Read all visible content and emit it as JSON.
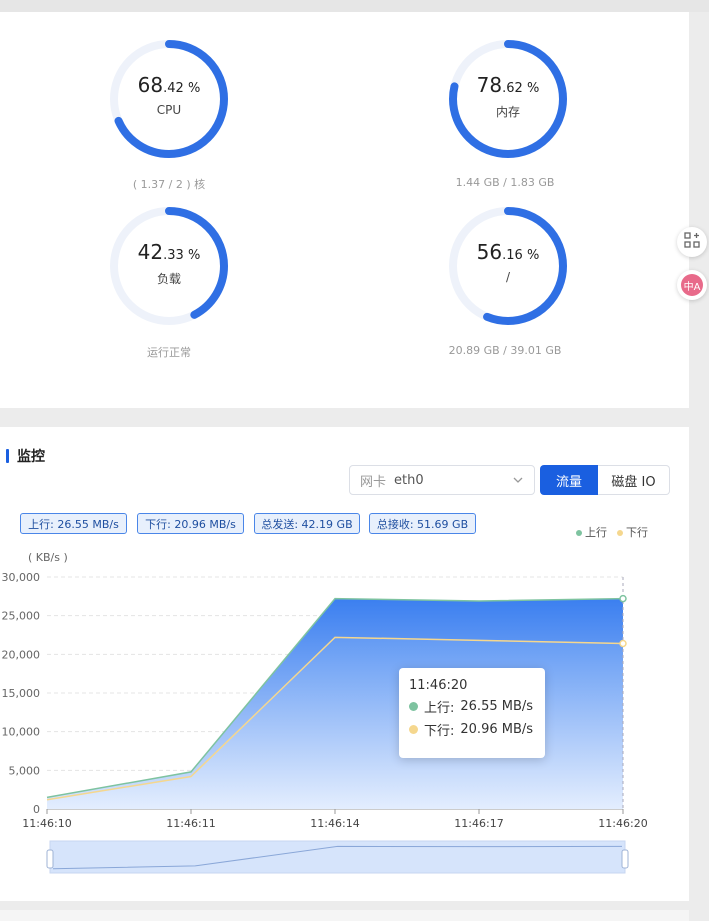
{
  "gauges": [
    {
      "int": "68",
      "dec": ".42",
      "unit": "%",
      "label": "CPU",
      "sub": "( 1.37 / 2 ) 核",
      "percent": 68.42
    },
    {
      "int": "78",
      "dec": ".62",
      "unit": "%",
      "label": "内存",
      "sub": "1.44 GB / 1.83 GB",
      "percent": 78.62
    },
    {
      "int": "42",
      "dec": ".33",
      "unit": "%",
      "label": "负载",
      "sub": "运行正常",
      "percent": 42.33
    },
    {
      "int": "56",
      "dec": ".16",
      "unit": "%",
      "label": "/",
      "sub": "20.89 GB / 39.01 GB",
      "percent": 56.16
    }
  ],
  "monitor": {
    "title": "监控",
    "nic_prefix": "网卡",
    "nic_value": "eth0",
    "tabs": [
      "流量",
      "磁盘 IO"
    ],
    "tags": [
      "上行: 26.55 MB/s",
      "下行: 20.96 MB/s",
      "总发送: 42.19 GB",
      "总接收: 51.69 GB"
    ]
  },
  "side_icons": [
    "apps-add-icon",
    "translate-icon"
  ],
  "translate_label": "中A",
  "tooltip": {
    "time": "11:46:20",
    "up_label": "上行:",
    "up_value": "26.55 MB/s",
    "down_label": "下行:",
    "down_value": "20.96 MB/s"
  },
  "chart_data": {
    "type": "area",
    "ylabel": "( KB/s )",
    "x": [
      "11:46:10",
      "11:46:11",
      "11:46:14",
      "11:46:17",
      "11:46:20"
    ],
    "ylim": [
      0,
      30000
    ],
    "yticks": [
      "0",
      "5,000",
      "10,000",
      "15,000",
      "20,000",
      "25,000",
      "30,000"
    ],
    "series": [
      {
        "name": "上行",
        "values": [
          1500,
          4800,
          27200,
          26900,
          27200
        ],
        "color": "#7ec3a0"
      },
      {
        "name": "下行",
        "values": [
          1200,
          4200,
          22200,
          21800,
          21400
        ],
        "color": "#f5d78e"
      }
    ],
    "colors": {
      "area": "#3b7ff0",
      "grid": "#e4e4e4"
    }
  }
}
